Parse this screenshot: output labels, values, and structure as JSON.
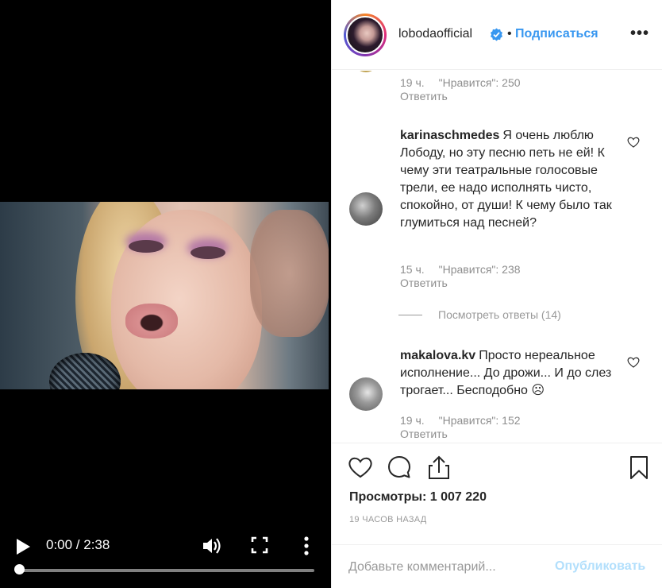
{
  "video": {
    "time": "0:00 / 2:38",
    "progress": 0.0
  },
  "header": {
    "username": "lobodaofficial",
    "follow": "Подписаться",
    "options": "•••",
    "verified": true
  },
  "comments": [
    {
      "partial": true,
      "time": "19 ч.",
      "likes": "\"Нравится\": 250",
      "reply": "Ответить"
    },
    {
      "user": "karinaschmedes",
      "text": "Я очень люблю Лободу, но эту песню петь не ей! К чему эти театральные голосовые трели, ее надо исполнять чисто, спокойно, от души! К чему было так глумиться над песней?",
      "time": "15 ч.",
      "likes": "\"Нравится\": 238",
      "reply": "Ответить",
      "view_replies": "Посмотреть ответы (14)"
    },
    {
      "user": "makalova.kv",
      "text": "Просто нереальное исполнение... До дрожи... И до слез трогает... Бесподобно ☹",
      "time": "19 ч.",
      "likes": "\"Нравится\": 152",
      "reply": "Ответить"
    }
  ],
  "actions": {
    "views": "Просмотры: 1 007 220",
    "timestamp": "19 ЧАСОВ НАЗАД",
    "comment_placeholder": "Добавьте комментарий...",
    "publish": "Опубликовать"
  },
  "colors": {
    "accent": "#3897f0",
    "publish_disabled": "#b2dffc",
    "muted": "#8e8e8e"
  }
}
